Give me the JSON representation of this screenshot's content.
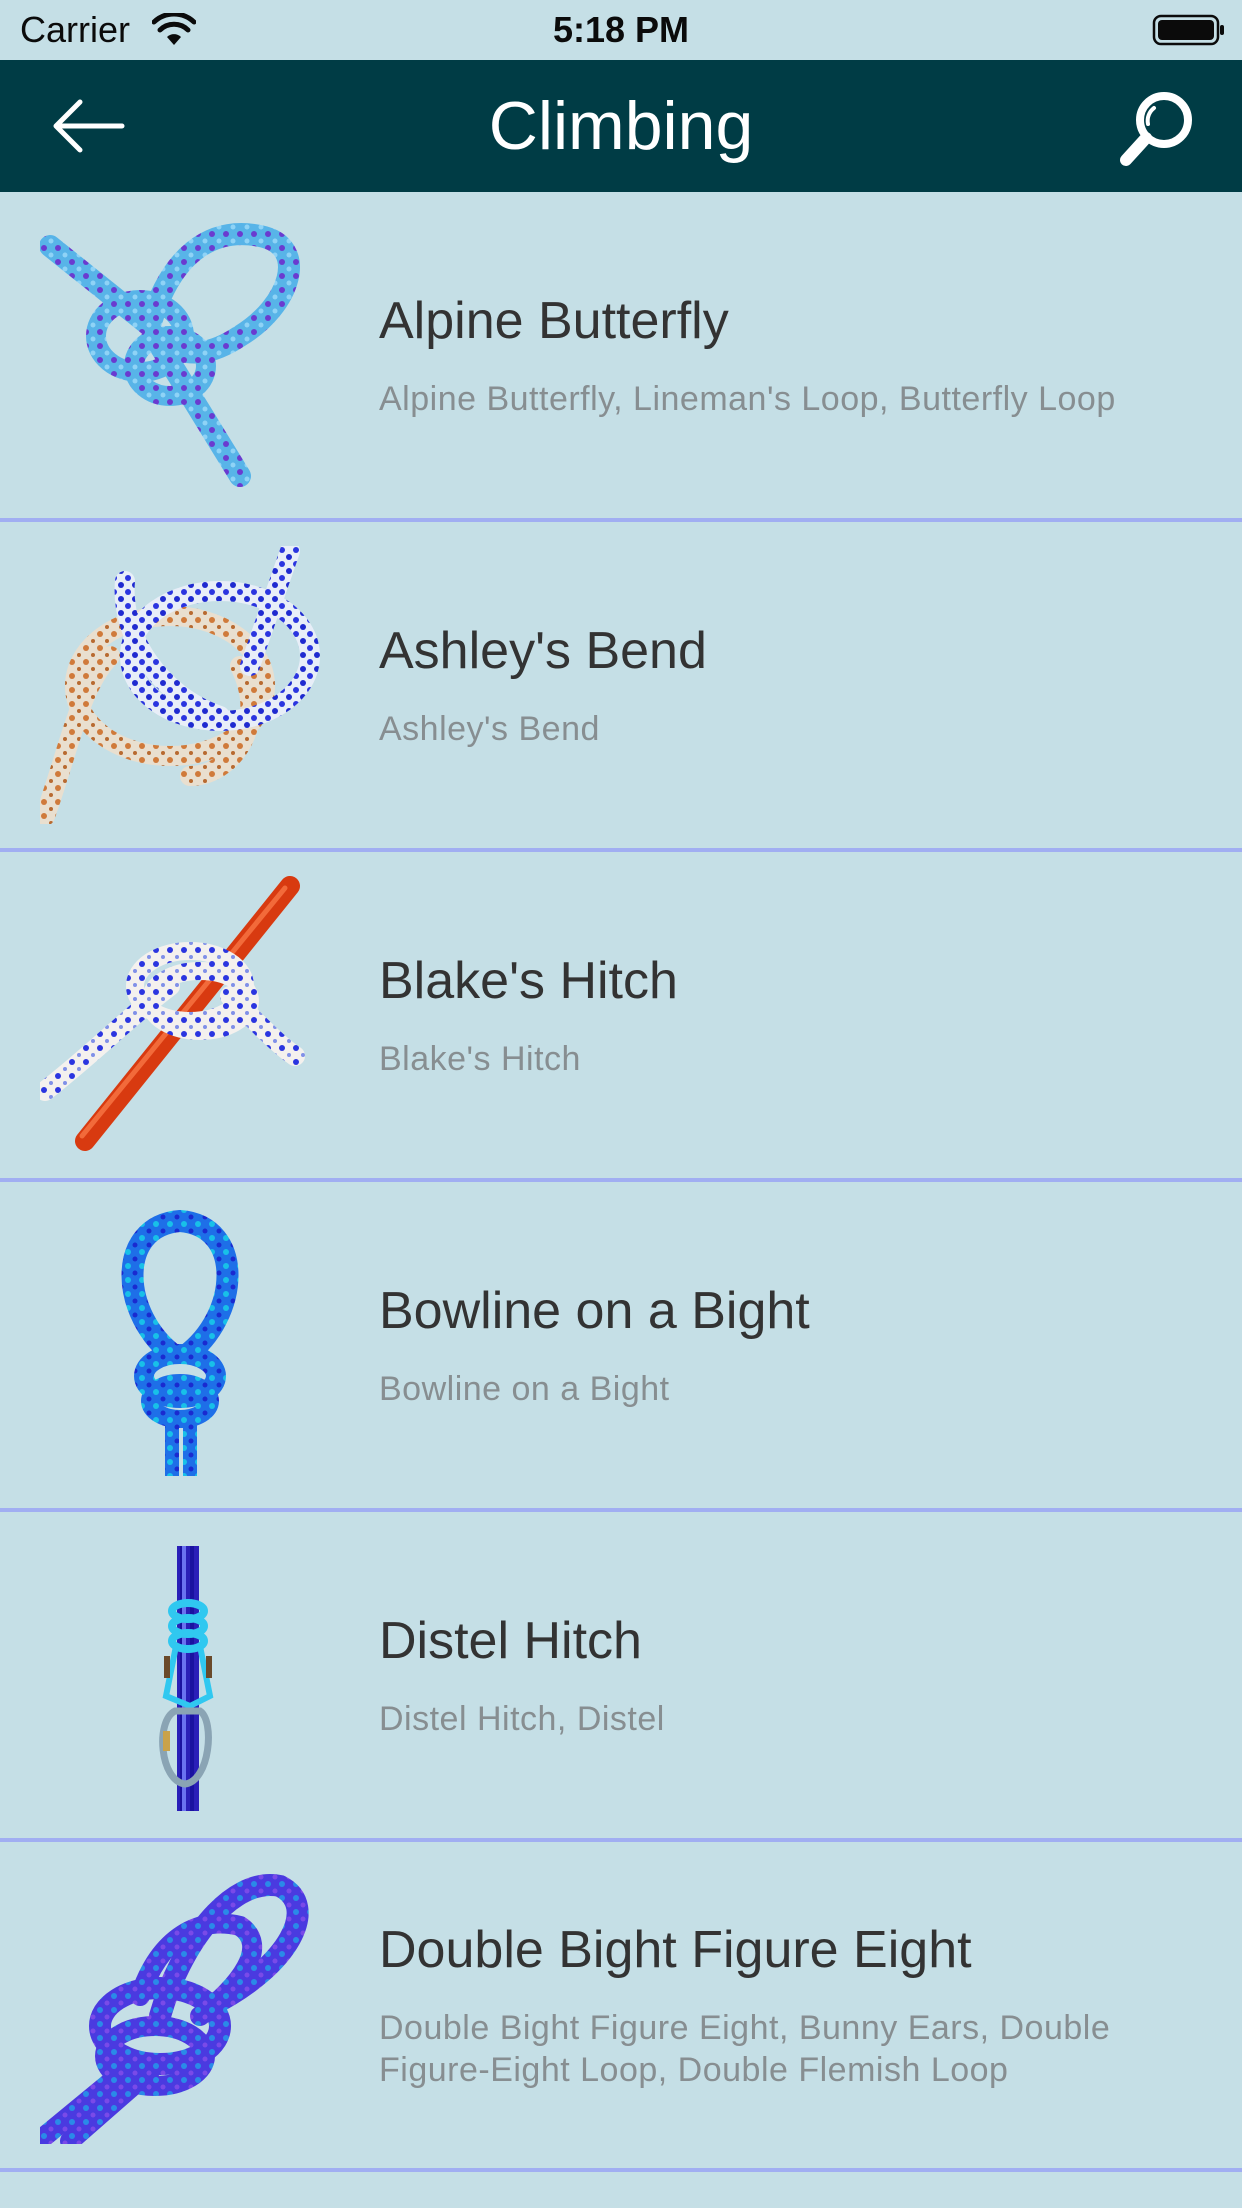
{
  "status_bar": {
    "carrier": "Carrier",
    "time": "5:18 PM",
    "wifi_icon": "wifi-icon",
    "battery_icon": "battery-icon"
  },
  "nav": {
    "title": "Climbing",
    "back_icon": "back-arrow-icon",
    "search_icon": "search-icon",
    "bar_color": "#003c45"
  },
  "colors": {
    "background": "#c5dfe6",
    "divider": "#a1aef2",
    "title_text": "#333333",
    "subtitle_text": "#878e91"
  },
  "knots": [
    {
      "title": "Alpine Butterfly",
      "subtitle": "Alpine Butterfly, Lineman's Loop, Butterfly Loop",
      "image": "alpine-butterfly-knot-image"
    },
    {
      "title": "Ashley's Bend",
      "subtitle": "Ashley's Bend",
      "image": "ashleys-bend-knot-image"
    },
    {
      "title": "Blake's Hitch",
      "subtitle": "Blake's Hitch",
      "image": "blakes-hitch-knot-image"
    },
    {
      "title": "Bowline on a Bight",
      "subtitle": "Bowline on a Bight",
      "image": "bowline-on-a-bight-knot-image"
    },
    {
      "title": "Distel Hitch",
      "subtitle": "Distel Hitch, Distel",
      "image": "distel-hitch-knot-image"
    },
    {
      "title": "Double Bight Figure Eight",
      "subtitle": "Double Bight Figure Eight, Bunny Ears, Double Figure-Eight Loop, Double Flemish Loop",
      "image": "double-bight-figure-eight-knot-image"
    }
  ]
}
